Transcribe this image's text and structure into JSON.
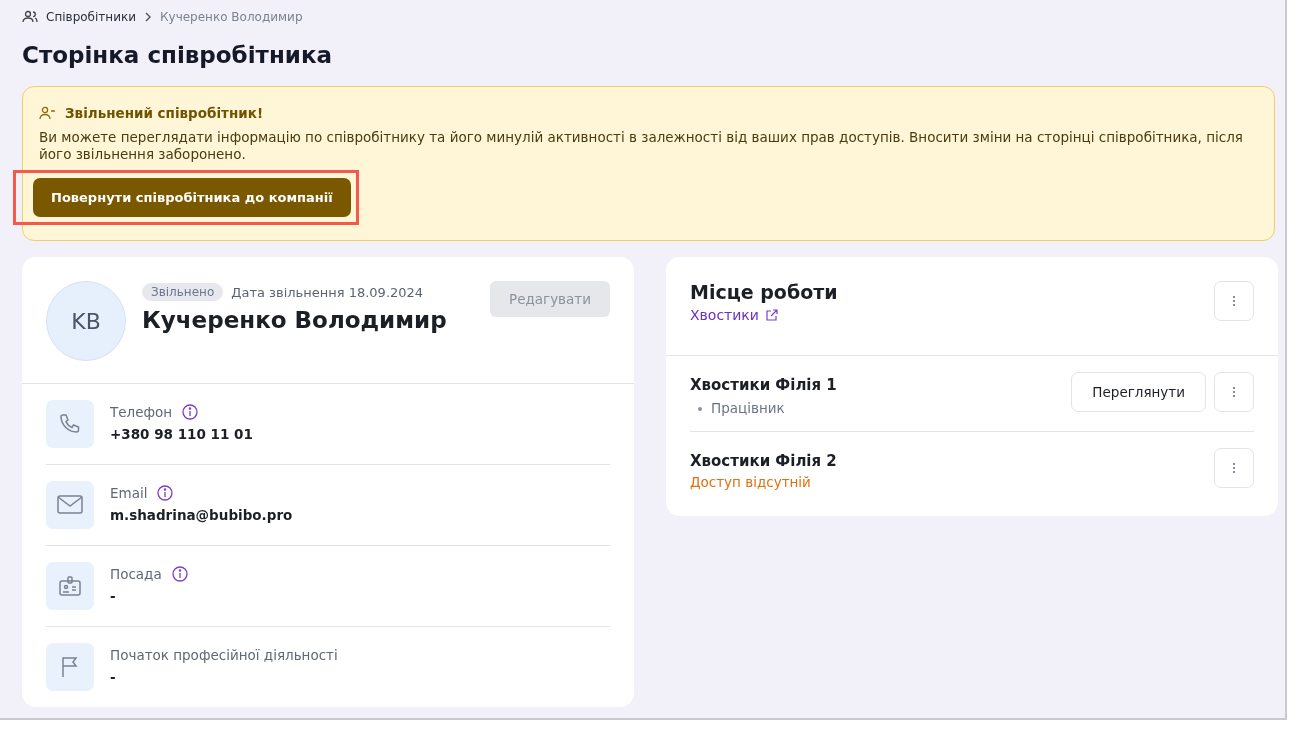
{
  "breadcrumbs": [
    {
      "label": "Співробітники",
      "current": false
    },
    {
      "label": "Кучеренко Володимир",
      "current": true
    }
  ],
  "page_title": "Сторінка співробітника",
  "alert": {
    "title": "Звільнений співробітник!",
    "text": "Ви можете переглядати інформацію по співробітнику та його минулій активності в залежності від ваших прав доступів. Вносити зміни на сторінці співробітника, після його звільнення заборонено.",
    "button": {
      "label": "Повернути співробітника до компанії",
      "highlighted": true
    }
  },
  "profile": {
    "initials": "KB",
    "status_badge": "Звільнено",
    "dismissal_date": "Дата звільнення 18.09.2024",
    "name": "Кучеренко Володимир",
    "edit_button": {
      "label": "Редагувати",
      "disabled": true
    },
    "fields": [
      {
        "kind": "phone",
        "label": "Телефон",
        "info": true,
        "value": "+380 98 110 11 01"
      },
      {
        "kind": "email",
        "label": "Email",
        "info": true,
        "value": "m.shadrina@bubibo.pro"
      },
      {
        "kind": "position",
        "label": "Посада",
        "info": true,
        "value": "-"
      },
      {
        "kind": "career_start",
        "label": "Початок професійної діяльності",
        "info": false,
        "value": "-"
      }
    ]
  },
  "workplace": {
    "title": "Місце роботи",
    "company_link": "Хвостики",
    "branches": [
      {
        "kind": "member",
        "name": "Хвостики Філія 1",
        "roles": [
          "Працівник"
        ],
        "view_button": "Переглянути"
      },
      {
        "kind": "no_access",
        "name": "Хвостики Філія 2",
        "status": "Доступ відсутній"
      }
    ]
  }
}
